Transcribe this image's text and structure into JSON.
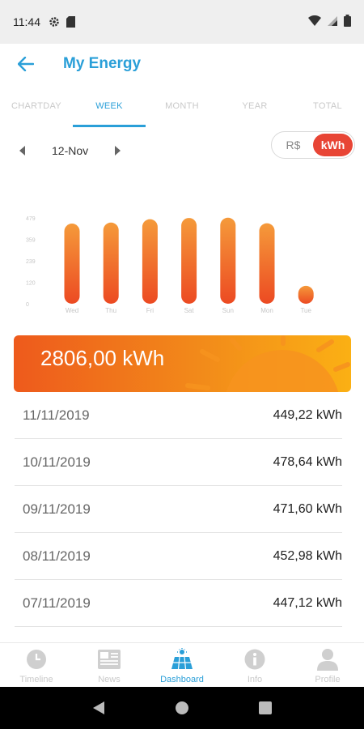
{
  "status": {
    "time": "11:44"
  },
  "header": {
    "title": "My Energy"
  },
  "tabs": [
    {
      "label": "CHARTDAY"
    },
    {
      "label": "WEEK"
    },
    {
      "label": "MONTH"
    },
    {
      "label": "YEAR"
    },
    {
      "label": "TOTAL"
    }
  ],
  "active_tab": "WEEK",
  "date_nav": {
    "label": "12-Nov"
  },
  "unit_toggle": {
    "currency": "R$",
    "energy": "kWh",
    "selected": "kWh"
  },
  "chart_data": {
    "type": "bar",
    "categories": [
      "Wed",
      "Thu",
      "Fri",
      "Sat",
      "Sun",
      "Mon",
      "Tue"
    ],
    "values": [
      447.12,
      452.98,
      471.6,
      478.64,
      480,
      449.22,
      100
    ],
    "yticks": [
      "479",
      "359",
      "239",
      "120",
      "0"
    ],
    "ylim": [
      0,
      479
    ]
  },
  "total": {
    "value": "2806,00 kWh"
  },
  "history": [
    {
      "date": "11/11/2019",
      "value": "449,22 kWh"
    },
    {
      "date": "10/11/2019",
      "value": "478,64 kWh"
    },
    {
      "date": "09/11/2019",
      "value": "471,60 kWh"
    },
    {
      "date": "08/11/2019",
      "value": "452,98 kWh"
    },
    {
      "date": "07/11/2019",
      "value": "447,12 kWh"
    }
  ],
  "bottom_nav": [
    {
      "label": "Timeline",
      "icon": "clock-icon"
    },
    {
      "label": "News",
      "icon": "newspaper-icon"
    },
    {
      "label": "Dashboard",
      "icon": "solar-panel-icon"
    },
    {
      "label": "Info",
      "icon": "info-icon"
    },
    {
      "label": "Profile",
      "icon": "user-icon"
    }
  ],
  "active_nav": "Dashboard",
  "colors": {
    "accent": "#2a9fd8",
    "toggle_active": "#e84535",
    "bar_top": "#f59a3a",
    "bar_bottom": "#ec4a22"
  }
}
